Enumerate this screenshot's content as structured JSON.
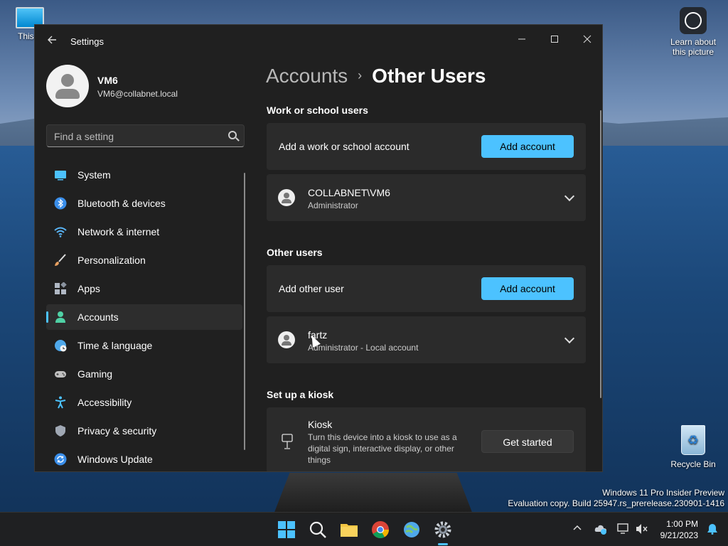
{
  "desktop": {
    "this_pc_label": "This P",
    "learn_label": "Learn about this picture",
    "recycle_label": "Recycle Bin",
    "watermark_line1": "Windows 11 Pro Insider Preview",
    "watermark_line2": "Evaluation copy. Build 25947.rs_prerelease.230901-1416"
  },
  "window": {
    "title": "Settings",
    "profile": {
      "name": "VM6",
      "email": "VM6@collabnet.local"
    },
    "search": {
      "placeholder": "Find a setting"
    },
    "nav": [
      {
        "label": "System",
        "icon": "system-icon",
        "color": "#4cc2ff"
      },
      {
        "label": "Bluetooth & devices",
        "icon": "bluetooth-icon",
        "color": "#3a8eea"
      },
      {
        "label": "Network & internet",
        "icon": "wifi-icon",
        "color": "#59b4f5"
      },
      {
        "label": "Personalization",
        "icon": "brush-icon",
        "color": "#e8a060"
      },
      {
        "label": "Apps",
        "icon": "apps-icon",
        "color": "#b0b8c4"
      },
      {
        "label": "Accounts",
        "icon": "person-icon",
        "color": "#4fd1a5",
        "active": true
      },
      {
        "label": "Time & language",
        "icon": "globe-icon",
        "color": "#4fa8ea"
      },
      {
        "label": "Gaming",
        "icon": "gamepad-icon",
        "color": "#c0c0c0"
      },
      {
        "label": "Accessibility",
        "icon": "accessibility-icon",
        "color": "#4cc2ff"
      },
      {
        "label": "Privacy & security",
        "icon": "shield-icon",
        "color": "#a0a8b4"
      },
      {
        "label": "Windows Update",
        "icon": "update-icon",
        "color": "#3a8eea"
      }
    ]
  },
  "main": {
    "breadcrumb_parent": "Accounts",
    "breadcrumb_sep": "›",
    "breadcrumb_current": "Other Users",
    "work_section": {
      "title": "Work or school users",
      "add_label": "Add a work or school account",
      "add_button": "Add account",
      "user_name": "COLLABNET\\VM6",
      "user_role": "Administrator"
    },
    "other_section": {
      "title": "Other users",
      "add_label": "Add other user",
      "add_button": "Add account",
      "user_name": "fartz",
      "user_role": "Administrator - Local account"
    },
    "kiosk_section": {
      "title": "Set up a kiosk",
      "card_title": "Kiosk",
      "description": "Turn this device into a kiosk to use as a digital sign, interactive display, or other things",
      "button": "Get started"
    }
  },
  "taskbar": {
    "time": "1:00 PM",
    "date": "9/21/2023",
    "accent": "#4cc2ff"
  }
}
